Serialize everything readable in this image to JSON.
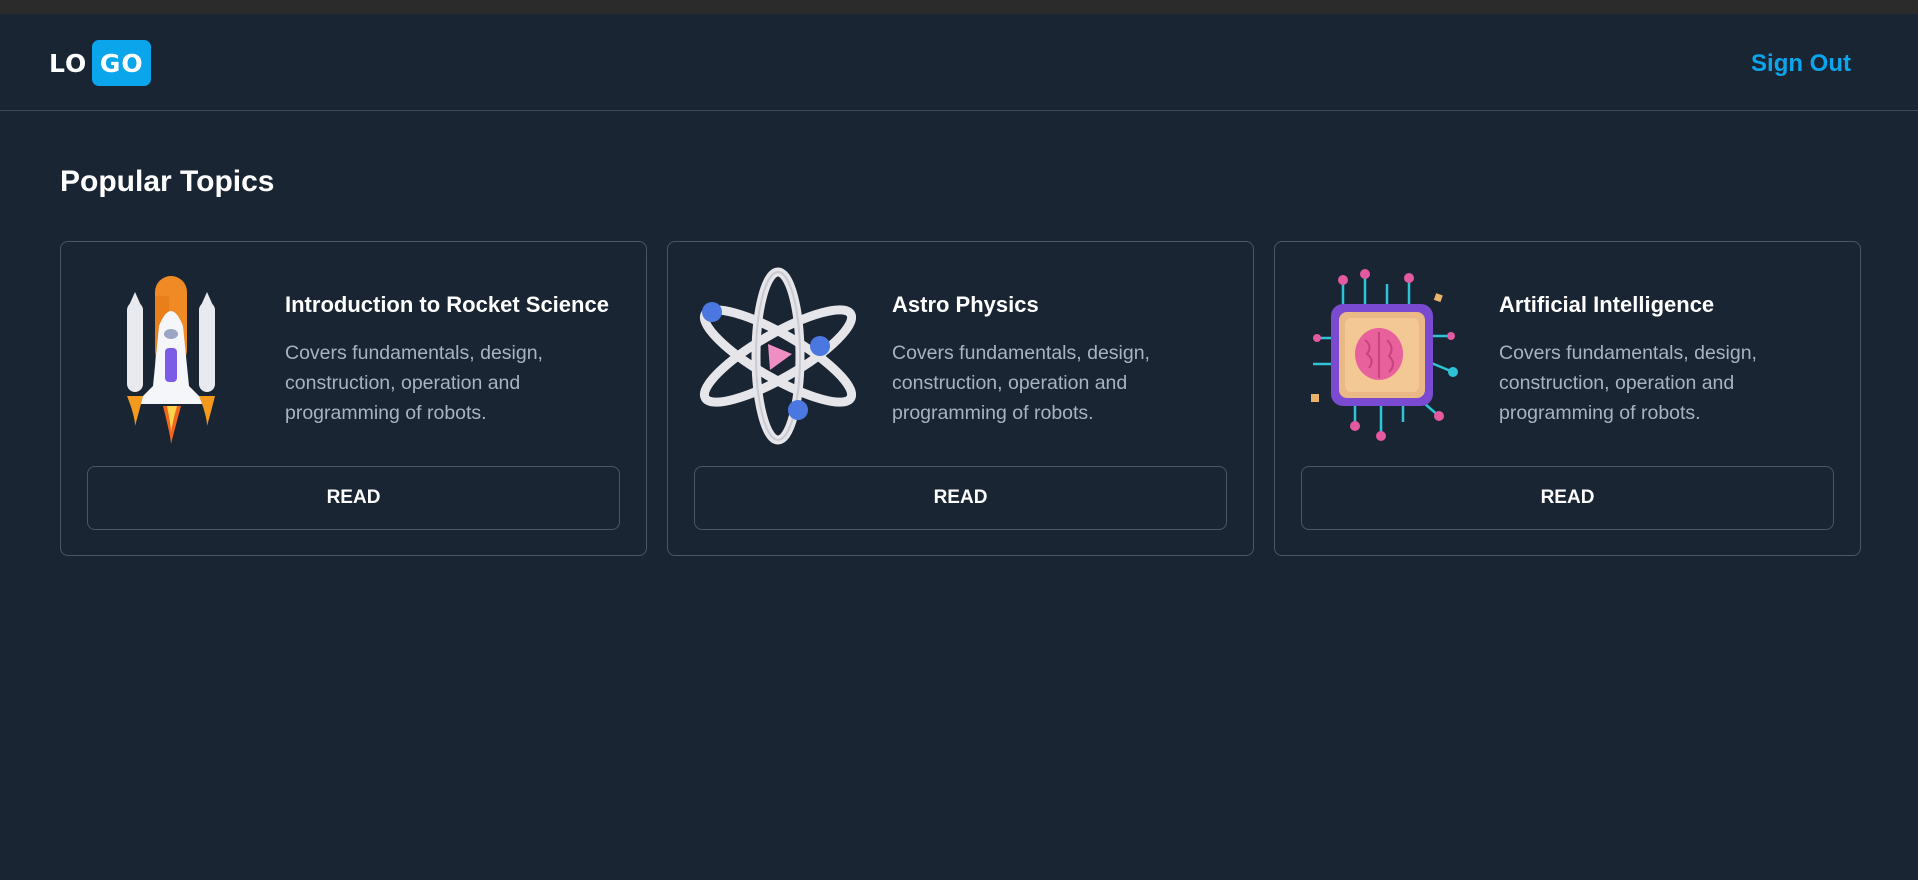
{
  "header": {
    "logo_left": "LO",
    "logo_right": "GO",
    "sign_out_label": "Sign Out"
  },
  "main": {
    "title": "Popular Topics",
    "cards": [
      {
        "icon": "rocket-icon",
        "title": "Introduction to Rocket Science",
        "description": "Covers fundamentals, design, construction, operation and programming of robots.",
        "button_label": "READ"
      },
      {
        "icon": "atom-icon",
        "title": "Astro Physics",
        "description": "Covers fundamentals, design, construction, operation and programming of robots.",
        "button_label": "READ"
      },
      {
        "icon": "ai-chip-icon",
        "title": "Artificial Intelligence",
        "description": "Covers fundamentals, design, construction, operation and programming of robots.",
        "button_label": "READ"
      }
    ]
  },
  "colors": {
    "background": "#1a2533",
    "accent": "#0ba5ec",
    "border": "#4a5666",
    "muted_text": "#a9b3c0"
  }
}
